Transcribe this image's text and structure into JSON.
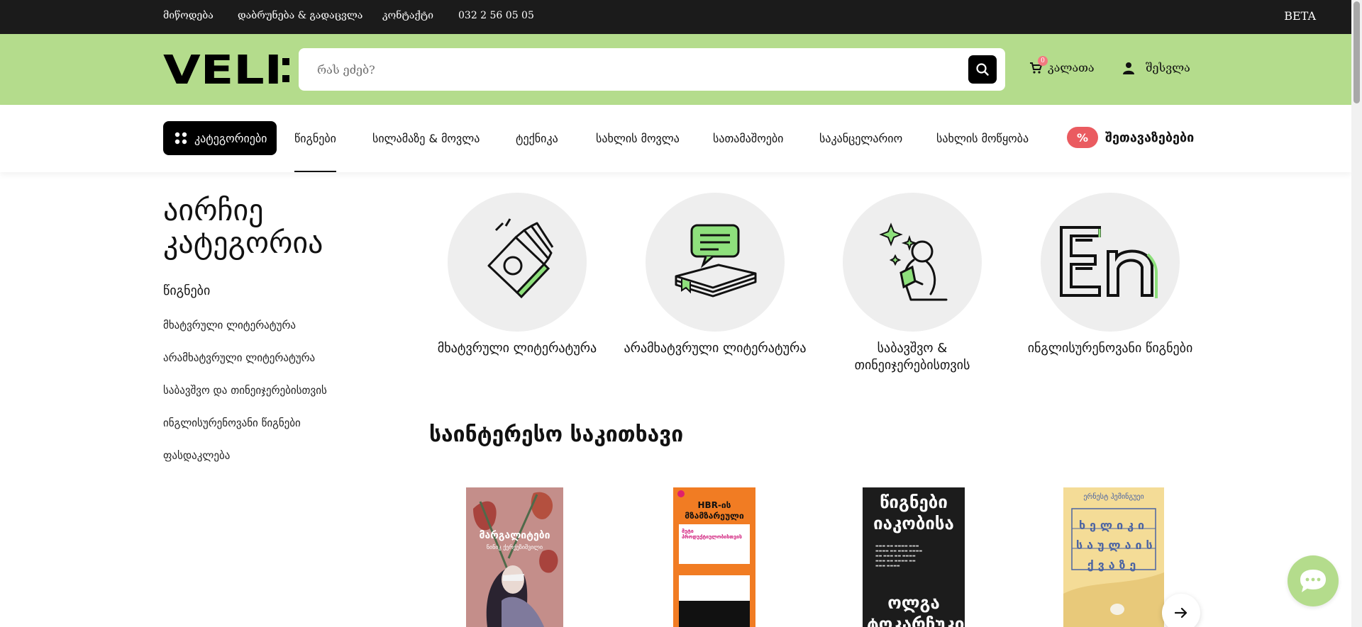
{
  "topbar": {
    "links": [
      "მიწოდება",
      "დაბრუნება & გადაცვლა",
      "კონტაქტი",
      "032 2 56 05 05"
    ],
    "beta": "BETA"
  },
  "header": {
    "logo": "VELI:",
    "search_placeholder": "რას ეძებ?",
    "cart_label": "კალათა",
    "cart_count": "0",
    "login_label": "შესვლა"
  },
  "catnav": {
    "categories_button": "კატეგორიები",
    "items": [
      "წიგნები",
      "სილამაზე & მოვლა",
      "ტექნიკა",
      "სახლის მოვლა",
      "სათამაშოები",
      "საკანცელარიო",
      "სახლის მოწყობა"
    ],
    "deals_badge": "%",
    "deals_label": "შეთავაზებები"
  },
  "sidebar": {
    "title": "აირჩიე კატეგორია",
    "heading": "წიგნები",
    "links": [
      "მხატვრული ლიტერატურა",
      "არამხატვრული ლიტერატურა",
      "საბავშვო და თინეიჯერებისთვის",
      "ინგლისურენოვანი წიგნები",
      "ფასდაკლება"
    ]
  },
  "categories": [
    {
      "label": "მხატვრული ლიტერატურა",
      "icon": "open-book-icon"
    },
    {
      "label": "არამხატვრული ლიტერატურა",
      "icon": "book-speech-icon"
    },
    {
      "label": "საბავშვო & თინეიჯერებისთვის",
      "icon": "child-reading-icon"
    },
    {
      "label": "ინგლისურენოვანი წიგნები",
      "icon": "english-letters-icon"
    }
  ],
  "section_title": "საინტერესო საკითხავი",
  "books": [
    {
      "title": "მარგალიტები",
      "author": "ნინიკ ქერქეზიშვილი"
    },
    {
      "title": "HBR-ის მზამზარეული",
      "subtitle": "მეტი პროდუქტიულობისთვის"
    },
    {
      "title": "წიგნები იაკობისა",
      "author": "ოლგა ტოკარჩუკი"
    },
    {
      "title": "ხელიკი საულაის ქვაზე",
      "author": "ერნესტ ჰემინგუეი"
    }
  ],
  "colors": {
    "topbar": "#1b1b1b",
    "header_green": "#b4dc8c",
    "deal_red": "#ea5b60",
    "accent_green": "#8ee07c"
  }
}
